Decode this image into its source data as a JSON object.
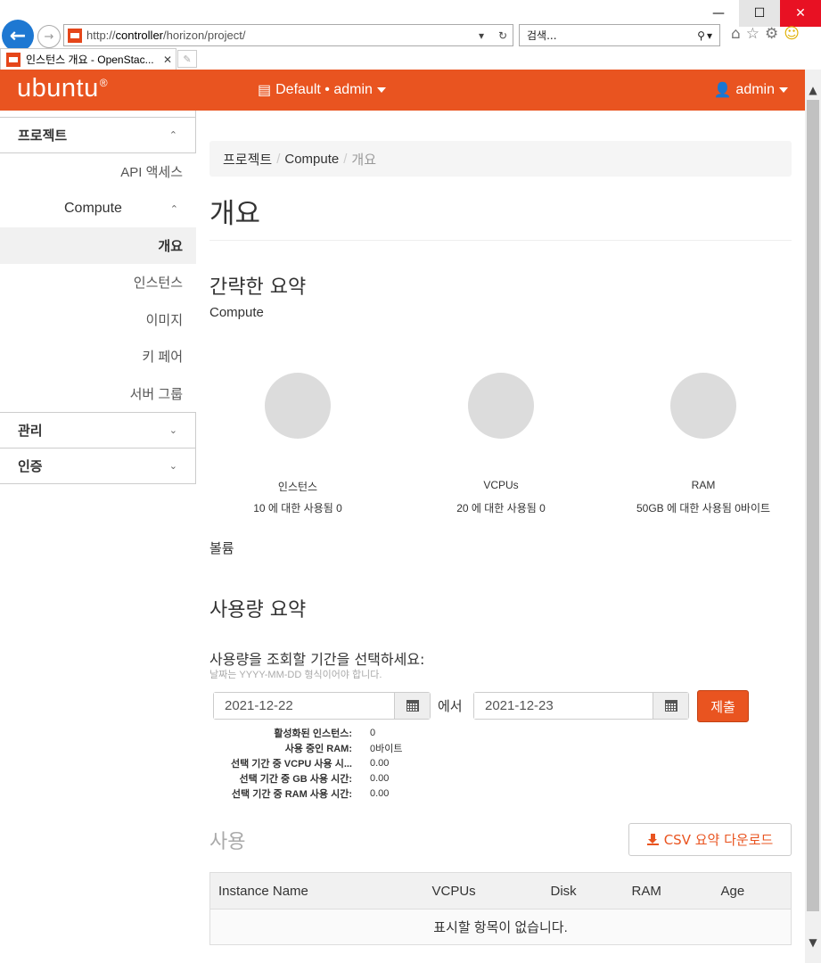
{
  "browser": {
    "url_prefix": "http://",
    "url_host": "controller",
    "url_path": "/horizon/project/",
    "search_placeholder": "검색...",
    "tab_title": "인스턴스 개요 - OpenStac...",
    "window_controls": {
      "minimize": "—",
      "maximize": "☐",
      "close": "✕"
    }
  },
  "topbar": {
    "logo": "ubuntu",
    "logo_mark": "®",
    "project_selector": "Default • admin",
    "user_menu": "admin",
    "brand_color": "#e95420"
  },
  "sidebar": {
    "project": "프로젝트",
    "api_access": "API 액세스",
    "compute": "Compute",
    "compute_items": [
      "개요",
      "인스턴스",
      "이미지",
      "키 페어",
      "서버 그룹"
    ],
    "admin": "관리",
    "identity": "인증"
  },
  "breadcrumb": {
    "items": [
      "프로젝트",
      "Compute",
      "개요"
    ],
    "separator": "/"
  },
  "page": {
    "title": "개요",
    "limit_summary_heading": "간략한 요약",
    "compute_label": "Compute",
    "volume_label": "볼륨",
    "usage_summary_heading": "사용량 요약",
    "period_label": "사용량을 조회할 기간을 선택하세요:",
    "period_help": "날짜는 YYYY-MM-DD 형식이어야 합니다.",
    "from_label": "에서",
    "submit": "제출",
    "usage_heading": "사용",
    "csv_button": "CSV 요약 다운로드"
  },
  "quotas": [
    {
      "label": "인스턴스",
      "used_text": "10 에 대한 사용됨 0"
    },
    {
      "label": "VCPUs",
      "used_text": "20 에 대한 사용됨 0"
    },
    {
      "label": "RAM",
      "used_text": "50GB 에 대한 사용됨 0바이트"
    }
  ],
  "dates": {
    "start": "2021-12-22",
    "end": "2021-12-23"
  },
  "stats": [
    {
      "key": "활성화된 인스턴스:",
      "value": "0"
    },
    {
      "key": "사용 중인 RAM:",
      "value": "0바이트"
    },
    {
      "key": "선택 기간 중 VCPU 사용 시...",
      "value": "0.00"
    },
    {
      "key": "선택 기간 중 GB 사용 시간:",
      "value": "0.00"
    },
    {
      "key": "선택 기간 중 RAM 사용 시간:",
      "value": "0.00"
    }
  ],
  "table": {
    "columns": [
      "Instance Name",
      "VCPUs",
      "Disk",
      "RAM",
      "Age"
    ],
    "empty_text": "표시할 항목이 없습니다."
  }
}
